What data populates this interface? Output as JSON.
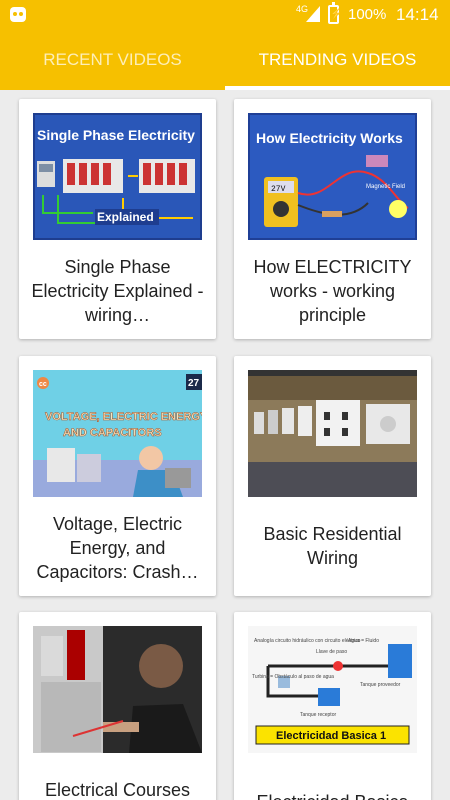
{
  "status_bar": {
    "network": "4G",
    "battery": "100%",
    "time": "14:14",
    "icons": [
      "app-icon",
      "signal-icon",
      "battery-charging-icon"
    ]
  },
  "tabs": [
    {
      "label": "RECENT VIDEOS",
      "active": false
    },
    {
      "label": "TRENDING VIDEOS",
      "active": true
    }
  ],
  "videos": [
    {
      "title": "Single Phase Electricity Explained - wiring…",
      "thumb_text": [
        "Single Phase Electricity",
        "Explained"
      ]
    },
    {
      "title": "How ELECTRICITY works - working principle",
      "thumb_text": [
        "How Electricity Works",
        "Magnetic Field",
        "27V"
      ]
    },
    {
      "title": "Voltage, Electric Energy, and Capacitors: Crash…",
      "thumb_text": [
        "VOLTAGE, ELECTRIC ENERGY,",
        "AND CAPACITORS",
        "27",
        "cc"
      ]
    },
    {
      "title": "Basic Residential Wiring",
      "thumb_text": []
    },
    {
      "title": "Electrical Courses Available at",
      "thumb_text": []
    },
    {
      "title": "Electricidad Basica",
      "thumb_text": [
        "Electricidad Basica 1",
        "Analogía circuito hidráulico con circuito eléctrico",
        "Agua = Fluido",
        "Llave de paso",
        "Tanque proveedor",
        "Turbina = Obstáculo al paso de agua",
        "Tanque receptor"
      ]
    }
  ],
  "colors": {
    "accent": "#f6c000",
    "background": "#ececec",
    "card": "#ffffff"
  }
}
